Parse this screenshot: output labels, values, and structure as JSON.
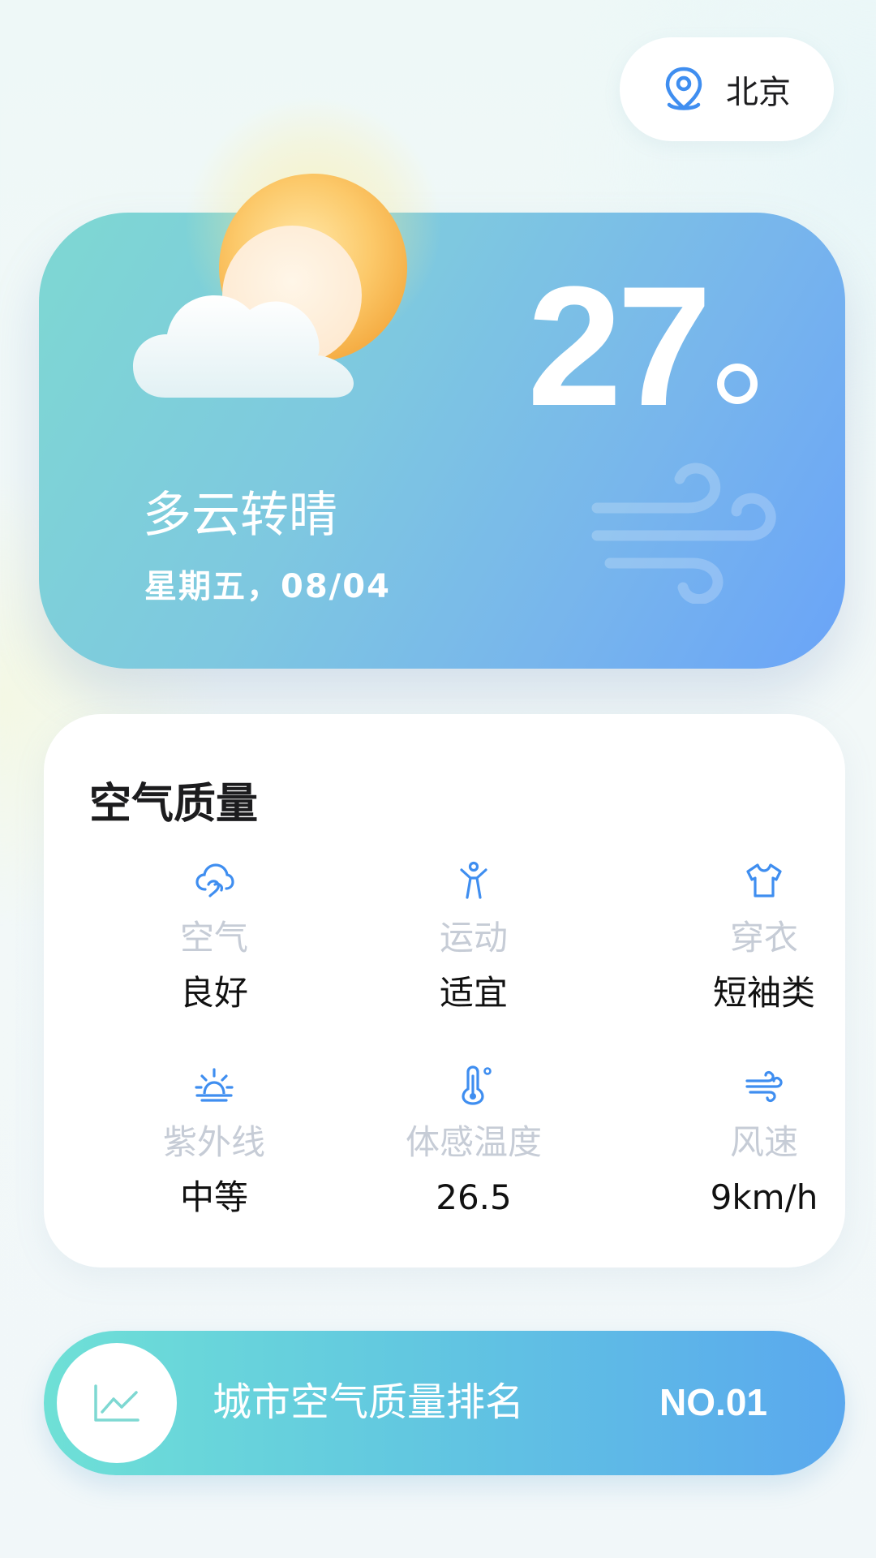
{
  "location": {
    "icon": "location-pin-icon",
    "city": "北京"
  },
  "weather": {
    "icon": "partly-cloudy-sun-icon",
    "temperature": "27",
    "degree_symbol": "°",
    "condition": "多云转晴",
    "date": "星期五，08/04",
    "decoration_icon": "wind-icon"
  },
  "air_quality": {
    "title": "空气质量",
    "items": [
      {
        "icon": "cloud-icon",
        "label": "空气",
        "value": "良好"
      },
      {
        "icon": "exercise-person-icon",
        "label": "运动",
        "value": "适宜"
      },
      {
        "icon": "tshirt-icon",
        "label": "穿衣",
        "value": "短袖类"
      },
      {
        "icon": "sunrise-icon",
        "label": "紫外线",
        "value": "中等"
      },
      {
        "icon": "thermometer-icon",
        "label": "体感温度",
        "value": "26.5"
      },
      {
        "icon": "wind-icon",
        "label": "风速",
        "value": "9km/h"
      }
    ]
  },
  "ranking": {
    "icon": "line-chart-icon",
    "label": "城市空气质量排名",
    "value": "NO.01"
  },
  "colors": {
    "accent_blue": "#3f8ef0",
    "card_gradient_start": "#7ed8d2",
    "card_gradient_end": "#6aa4f8",
    "rank_gradient_start": "#6ee0d6",
    "rank_gradient_end": "#5aa8ee",
    "muted_label": "#c6ccd6"
  }
}
